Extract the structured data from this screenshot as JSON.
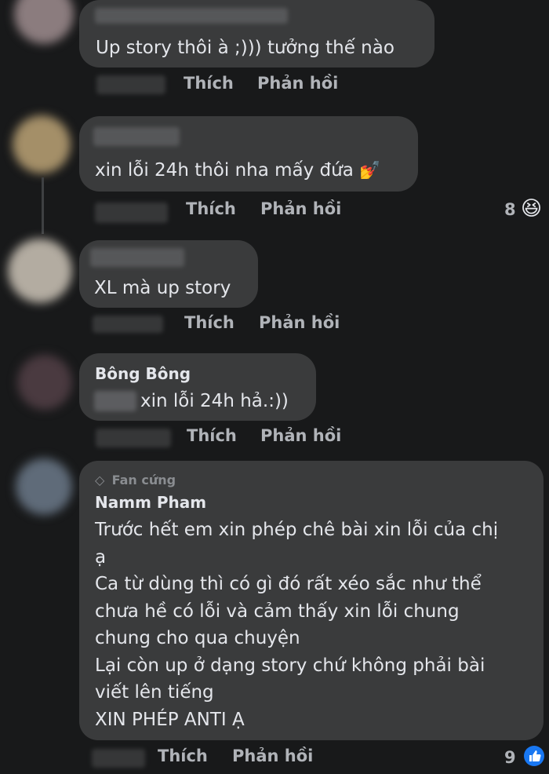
{
  "comments": [
    {
      "text": "Up story thôi à ;))) tưởng thế nào",
      "like_label": "Thích",
      "reply_label": "Phản hồi"
    },
    {
      "text": "xin lỗi 24h thôi nha mấy đứa",
      "emoji": "💅",
      "like_label": "Thích",
      "reply_label": "Phản hồi",
      "reaction_count": "8",
      "reaction_emoji": "😆"
    },
    {
      "text": "XL mà up story",
      "like_label": "Thích",
      "reply_label": "Phản hồi"
    },
    {
      "author": "Bông Bông",
      "text": "xin lỗi 24h hả.:))",
      "like_label": "Thích",
      "reply_label": "Phản hồi"
    },
    {
      "badge": "Fan cứng",
      "author": "Namm Pham",
      "lines": [
        "Trước hết em xin phép chê bài xin lỗi của chị",
        "ạ",
        "Ca từ dùng thì có gì đó rất xéo sắc như thể",
        "chưa hề có lỗi và cảm thấy xin lỗi chung",
        "chung cho qua chuyện",
        "Lại còn up ở dạng story chứ không phải bài",
        "viết lên tiếng",
        "XIN PHÉP ANTI Ạ"
      ],
      "like_label": "Thích",
      "reply_label": "Phản hồi",
      "reaction_count": "9",
      "reaction_icon": "like-icon"
    }
  ]
}
